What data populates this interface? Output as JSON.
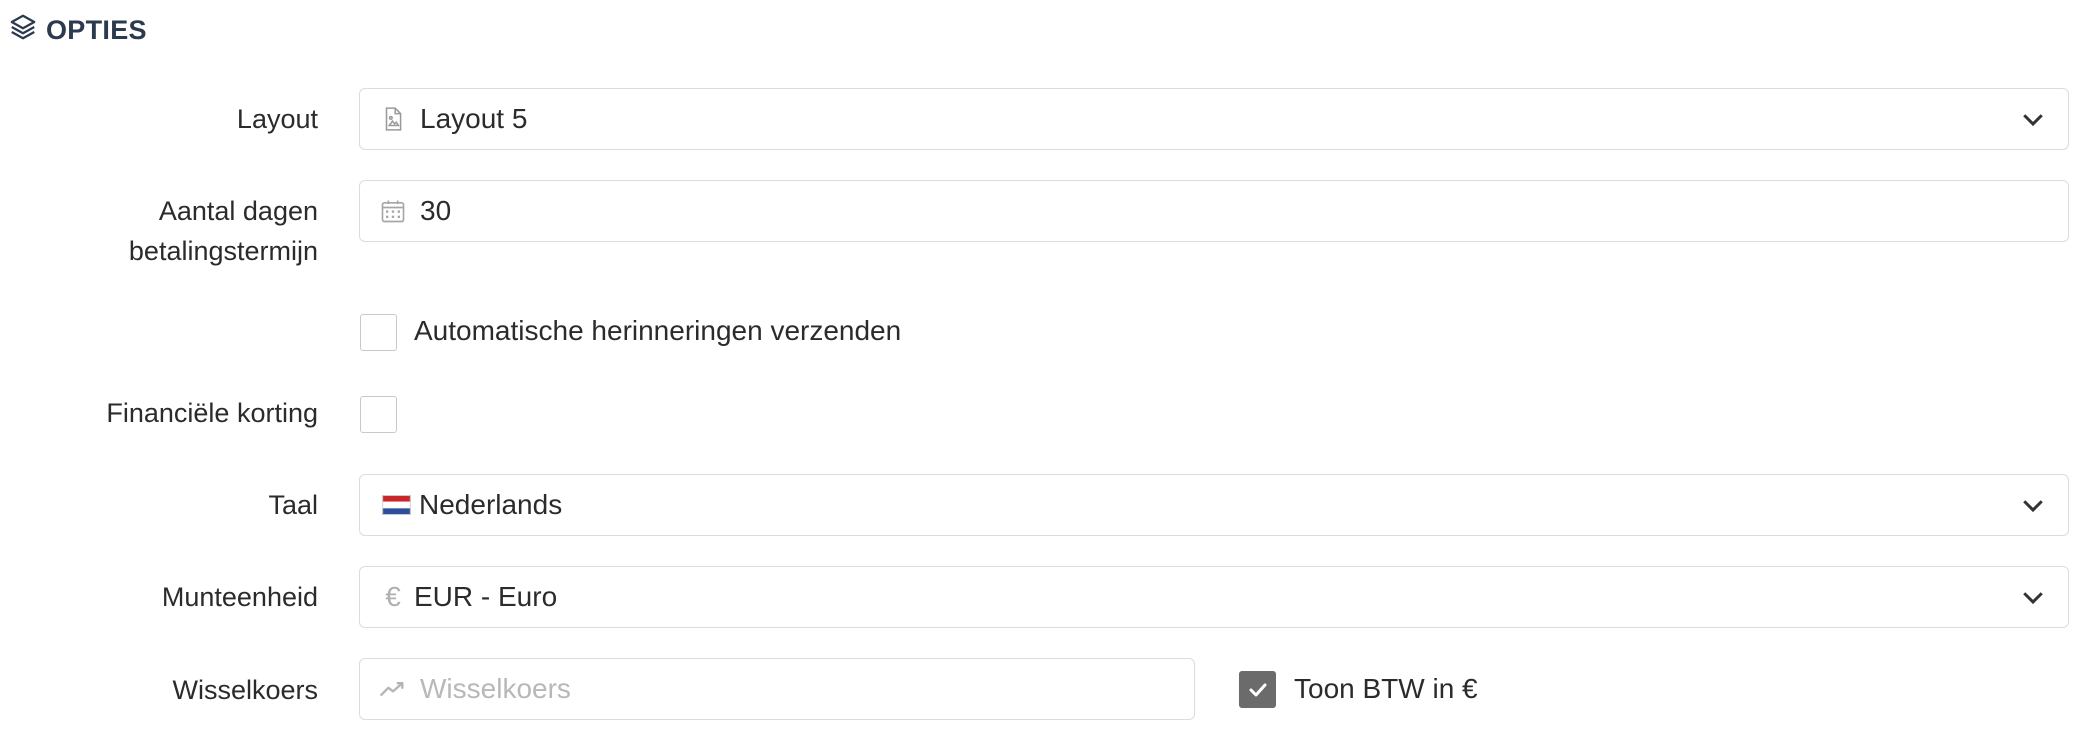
{
  "section": {
    "title": "OPTIES",
    "icon": "layers-icon"
  },
  "layout": {
    "label": "Layout",
    "value": "Layout 5",
    "icon": "document-image-icon"
  },
  "payment_term": {
    "label_line1": "Aantal dagen",
    "label_line2": "betalingstermijn",
    "value": "30",
    "icon": "calendar-icon"
  },
  "auto_reminders": {
    "label": "Automatische herinneringen verzenden",
    "checked": false
  },
  "financial_discount": {
    "label": "Financiële korting",
    "checked": false
  },
  "language": {
    "label": "Taal",
    "value": "Nederlands",
    "icon": "netherlands-flag-icon"
  },
  "currency": {
    "label": "Munteenheid",
    "symbol": "€",
    "value": "EUR - Euro"
  },
  "exchange_rate": {
    "label": "Wisselkoers",
    "placeholder": "Wisselkoers",
    "icon": "trend-line-icon"
  },
  "show_vat": {
    "label": "Toon BTW in €",
    "checked": true
  },
  "colors": {
    "title": "#2c3a4e",
    "border": "#dcdcdc",
    "checkbox_checked": "#6b6b6b",
    "placeholder": "#b8b8b8"
  }
}
